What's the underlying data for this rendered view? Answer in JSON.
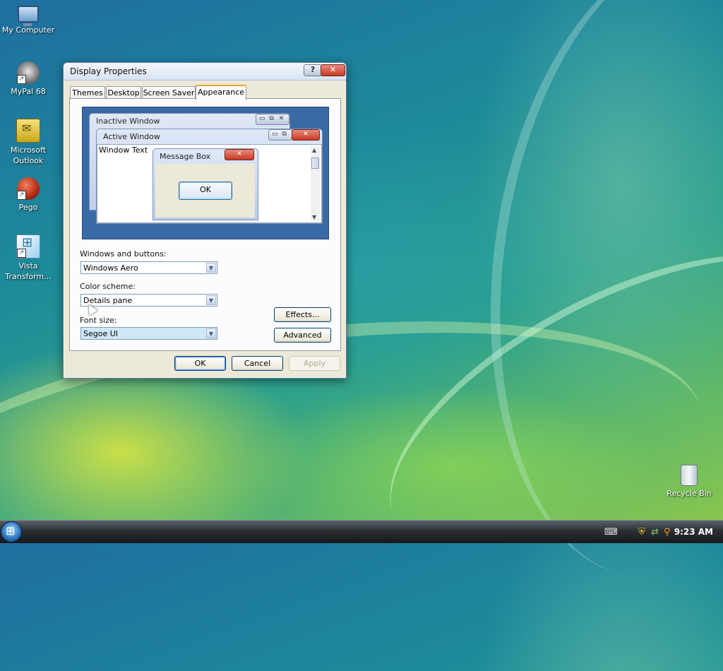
{
  "desktop": {
    "icons": [
      {
        "label": "My Computer"
      },
      {
        "label": "MyPal 68"
      },
      {
        "label": "Microsoft Outlook"
      },
      {
        "label": "Pego"
      },
      {
        "label": "Vista Transform..."
      },
      {
        "label": "Recycle Bin"
      }
    ]
  },
  "dialog": {
    "title": "Display Properties",
    "help_label": "?",
    "close_label": "✕",
    "tabs": [
      {
        "label": "Themes"
      },
      {
        "label": "Desktop"
      },
      {
        "label": "Screen Saver"
      },
      {
        "label": "Appearance",
        "active": true
      }
    ],
    "preview": {
      "inactive_title": "Inactive Window",
      "active_title": "Active Window",
      "window_text": "Window Text",
      "message_title": "Message Box",
      "ok_label": "OK",
      "min_glyph": "▭",
      "max_glyph": "⧉",
      "close_glyph": "✕"
    },
    "windows_buttons": {
      "label": "Windows and buttons:",
      "value": "Windows Aero"
    },
    "color_scheme": {
      "label": "Color scheme:",
      "value": "Details pane"
    },
    "font_size": {
      "label": "Font size:",
      "value": "Segoe UI"
    },
    "effects_label": "Effects...",
    "advanced_label": "Advanced",
    "ok_label": "OK",
    "cancel_label": "Cancel",
    "apply_label": "Apply"
  },
  "taskbar": {
    "clock": "9:23 AM",
    "tray_icons": [
      "keyboard-icon",
      "security-shield-icon",
      "network-icon",
      "search-icon"
    ]
  },
  "colors": {
    "active_tab_accent": "#e8a33c",
    "close_button": "#c63b24",
    "preview_background": "#3a6aa6"
  }
}
